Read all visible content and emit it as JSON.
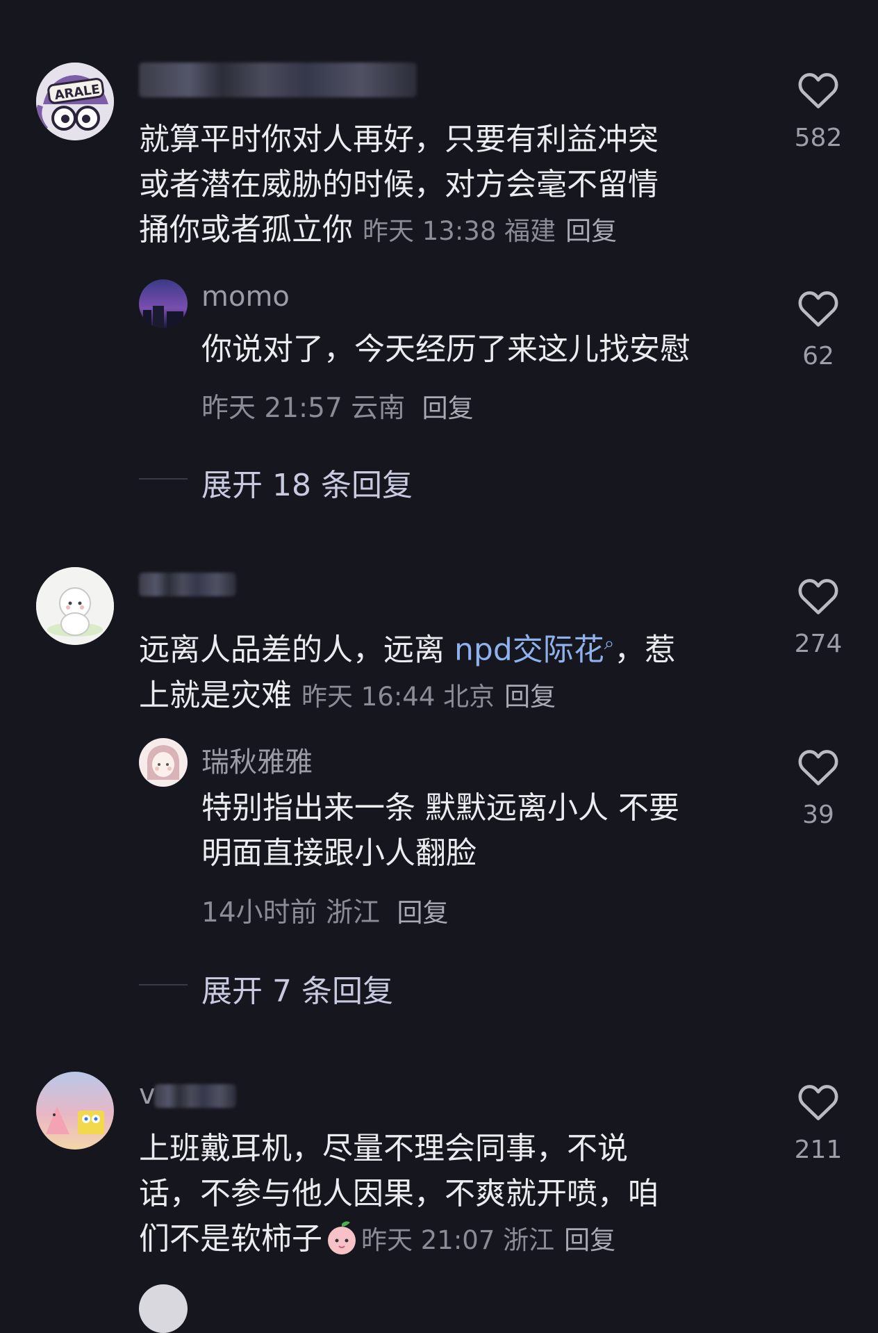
{
  "comments": [
    {
      "text_lines": [
        "就算平时你对人再好，只要有利益冲突",
        "或者潜在威胁的时候，对方会毫不留情",
        "捅你或者孤立你"
      ],
      "time": "昨天 13:38",
      "location": "福建",
      "reply_label": "回复",
      "likes": "582",
      "avatar": "arale-avatar",
      "replies": [
        {
          "username": "momo",
          "text_lines": [
            "你说对了，今天经历了来这儿找安慰"
          ],
          "time": "昨天 21:57",
          "location": "云南",
          "reply_label": "回复",
          "likes": "62"
        }
      ],
      "expand_label": "展开 18 条回复"
    },
    {
      "text_prefix": "远离人品差的人，远离 ",
      "link_text": "npd交际花",
      "link_suffix": "，惹",
      "text_line2": "上就是灾难",
      "time": "昨天 16:44",
      "location": "北京",
      "reply_label": "回复",
      "likes": "274",
      "replies": [
        {
          "username": "瑞秋雅雅",
          "text_lines": [
            "特别指出来一条 默默远离小人 不要",
            "明面直接跟小人翻脸"
          ],
          "time": "14小时前",
          "location": "浙江",
          "reply_label": "回复",
          "likes": "39"
        }
      ],
      "expand_label": "展开 7 条回复"
    },
    {
      "username_initial": "v",
      "text_lines": [
        "上班戴耳机，尽量不理会同事，不说",
        "话，不参与他人因果，不爽就开喷，咱",
        "们不是软柿子"
      ],
      "time": "昨天 21:07",
      "location": "浙江",
      "reply_label": "回复",
      "likes": "211"
    }
  ],
  "colors": {
    "background": "#16161e",
    "text": "#ececf0",
    "meta": "#8b8c96",
    "link": "#8fb2ee",
    "expand": "#c8cbe0"
  }
}
